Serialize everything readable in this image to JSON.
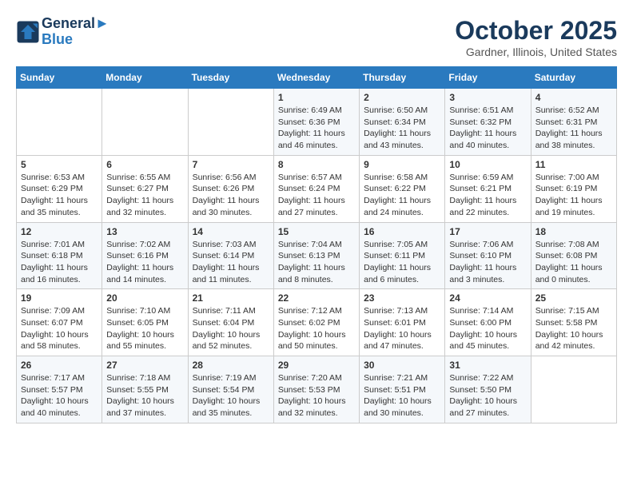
{
  "header": {
    "logo_line1": "General",
    "logo_line2": "Blue",
    "month": "October 2025",
    "location": "Gardner, Illinois, United States"
  },
  "weekdays": [
    "Sunday",
    "Monday",
    "Tuesday",
    "Wednesday",
    "Thursday",
    "Friday",
    "Saturday"
  ],
  "weeks": [
    [
      {
        "day": "",
        "info": ""
      },
      {
        "day": "",
        "info": ""
      },
      {
        "day": "",
        "info": ""
      },
      {
        "day": "1",
        "info": "Sunrise: 6:49 AM\nSunset: 6:36 PM\nDaylight: 11 hours and 46 minutes."
      },
      {
        "day": "2",
        "info": "Sunrise: 6:50 AM\nSunset: 6:34 PM\nDaylight: 11 hours and 43 minutes."
      },
      {
        "day": "3",
        "info": "Sunrise: 6:51 AM\nSunset: 6:32 PM\nDaylight: 11 hours and 40 minutes."
      },
      {
        "day": "4",
        "info": "Sunrise: 6:52 AM\nSunset: 6:31 PM\nDaylight: 11 hours and 38 minutes."
      }
    ],
    [
      {
        "day": "5",
        "info": "Sunrise: 6:53 AM\nSunset: 6:29 PM\nDaylight: 11 hours and 35 minutes."
      },
      {
        "day": "6",
        "info": "Sunrise: 6:55 AM\nSunset: 6:27 PM\nDaylight: 11 hours and 32 minutes."
      },
      {
        "day": "7",
        "info": "Sunrise: 6:56 AM\nSunset: 6:26 PM\nDaylight: 11 hours and 30 minutes."
      },
      {
        "day": "8",
        "info": "Sunrise: 6:57 AM\nSunset: 6:24 PM\nDaylight: 11 hours and 27 minutes."
      },
      {
        "day": "9",
        "info": "Sunrise: 6:58 AM\nSunset: 6:22 PM\nDaylight: 11 hours and 24 minutes."
      },
      {
        "day": "10",
        "info": "Sunrise: 6:59 AM\nSunset: 6:21 PM\nDaylight: 11 hours and 22 minutes."
      },
      {
        "day": "11",
        "info": "Sunrise: 7:00 AM\nSunset: 6:19 PM\nDaylight: 11 hours and 19 minutes."
      }
    ],
    [
      {
        "day": "12",
        "info": "Sunrise: 7:01 AM\nSunset: 6:18 PM\nDaylight: 11 hours and 16 minutes."
      },
      {
        "day": "13",
        "info": "Sunrise: 7:02 AM\nSunset: 6:16 PM\nDaylight: 11 hours and 14 minutes."
      },
      {
        "day": "14",
        "info": "Sunrise: 7:03 AM\nSunset: 6:14 PM\nDaylight: 11 hours and 11 minutes."
      },
      {
        "day": "15",
        "info": "Sunrise: 7:04 AM\nSunset: 6:13 PM\nDaylight: 11 hours and 8 minutes."
      },
      {
        "day": "16",
        "info": "Sunrise: 7:05 AM\nSunset: 6:11 PM\nDaylight: 11 hours and 6 minutes."
      },
      {
        "day": "17",
        "info": "Sunrise: 7:06 AM\nSunset: 6:10 PM\nDaylight: 11 hours and 3 minutes."
      },
      {
        "day": "18",
        "info": "Sunrise: 7:08 AM\nSunset: 6:08 PM\nDaylight: 11 hours and 0 minutes."
      }
    ],
    [
      {
        "day": "19",
        "info": "Sunrise: 7:09 AM\nSunset: 6:07 PM\nDaylight: 10 hours and 58 minutes."
      },
      {
        "day": "20",
        "info": "Sunrise: 7:10 AM\nSunset: 6:05 PM\nDaylight: 10 hours and 55 minutes."
      },
      {
        "day": "21",
        "info": "Sunrise: 7:11 AM\nSunset: 6:04 PM\nDaylight: 10 hours and 52 minutes."
      },
      {
        "day": "22",
        "info": "Sunrise: 7:12 AM\nSunset: 6:02 PM\nDaylight: 10 hours and 50 minutes."
      },
      {
        "day": "23",
        "info": "Sunrise: 7:13 AM\nSunset: 6:01 PM\nDaylight: 10 hours and 47 minutes."
      },
      {
        "day": "24",
        "info": "Sunrise: 7:14 AM\nSunset: 6:00 PM\nDaylight: 10 hours and 45 minutes."
      },
      {
        "day": "25",
        "info": "Sunrise: 7:15 AM\nSunset: 5:58 PM\nDaylight: 10 hours and 42 minutes."
      }
    ],
    [
      {
        "day": "26",
        "info": "Sunrise: 7:17 AM\nSunset: 5:57 PM\nDaylight: 10 hours and 40 minutes."
      },
      {
        "day": "27",
        "info": "Sunrise: 7:18 AM\nSunset: 5:55 PM\nDaylight: 10 hours and 37 minutes."
      },
      {
        "day": "28",
        "info": "Sunrise: 7:19 AM\nSunset: 5:54 PM\nDaylight: 10 hours and 35 minutes."
      },
      {
        "day": "29",
        "info": "Sunrise: 7:20 AM\nSunset: 5:53 PM\nDaylight: 10 hours and 32 minutes."
      },
      {
        "day": "30",
        "info": "Sunrise: 7:21 AM\nSunset: 5:51 PM\nDaylight: 10 hours and 30 minutes."
      },
      {
        "day": "31",
        "info": "Sunrise: 7:22 AM\nSunset: 5:50 PM\nDaylight: 10 hours and 27 minutes."
      },
      {
        "day": "",
        "info": ""
      }
    ]
  ]
}
